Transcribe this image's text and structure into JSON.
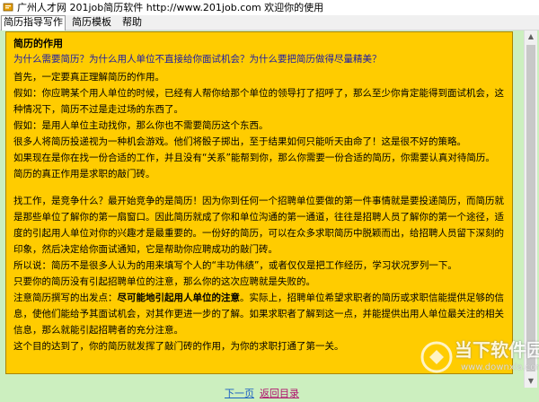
{
  "window": {
    "title": "广州人才网 201job简历软件 http://www.201job.com 欢迎你的使用"
  },
  "menu": {
    "items": [
      "简历指导写作",
      "简历模板",
      "帮助"
    ]
  },
  "content": {
    "heading": "简历的作用",
    "question": "为什么需要简历？为什么用人单位不直接给你面试机会？为什么要把简历做得尽量精美？",
    "paragraphs": [
      "首先，一定要真正理解简历的作用。",
      "假如：你应聘某个用人单位的时候，已经有人帮你给那个单位的领导打了招呼了，那么至少你肯定能得到面试机会，这种情况下，简历不过是走过场的东西了。",
      "假如：是用人单位主动找你，那么你也不需要简历这个东西。",
      "很多人将简历投递视为一种机会游戏。他们将骰子掷出，至于结果如何只能听天由命了！这是很不好的策略。",
      "如果现在是你在找一份合适的工作，并且没有“关系”能帮到你，那么你需要一份合适的简历，你需要认真对待简历。",
      "简历的真正作用是求职的敲门砖。"
    ],
    "paragraphs2": [
      "找工作，是竞争什么？最开始竞争的是简历！因为你到任何一个招聘单位要做的第一件事情就是要投递简历，而简历就是那些单位了解你的第一扇窗口。因此简历就成了你和单位沟通的第一通道，往往是招聘人员了解你的第一个途径，适度的引起用人单位对你的兴趣才是最重要的。一份好的简历，可以在众多求职简历中脱颖而出，给招聘人员留下深刻的印象，然后决定给你面试通知，它是帮助你应聘成功的敲门砖。",
      "所以说：简历不是很多人认为的用来填写个人的“丰功伟绩”，或者仅仅是把工作经历，学习状况罗列一下。",
      "只要你的简历没有引起招聘单位的注意，那么你的这次应聘就是失败的。"
    ],
    "emphasis": {
      "prefix": "注意简历撰写的出发点：",
      "bold": "尽可能地引起用人单位的注意",
      "suffix": "。实际上，招聘单位希望求职者的简历或求职信能提供足够的信息，使他们能给予其面试机会，对其作更进一步的了解。如果求职者了解到这一点，并能提供出用人单位最关注的相关信息，那么就能引起招聘者的充分注意。"
    },
    "closing": "这个目的达到了，你的简历就发挥了敲门砖的作用，为你的求职打通了第一关。"
  },
  "nav": {
    "next": "下一页",
    "back": "返回目录"
  },
  "watermark": {
    "site_name": "当下软件园",
    "domain": "www.downxia.com"
  },
  "colors": {
    "panel_bg": "#ffcc00",
    "workspace_bg": "#ccefbf",
    "question_text": "#1a1aa8",
    "next_link": "#1a5ec2",
    "back_link": "#b0126e"
  }
}
